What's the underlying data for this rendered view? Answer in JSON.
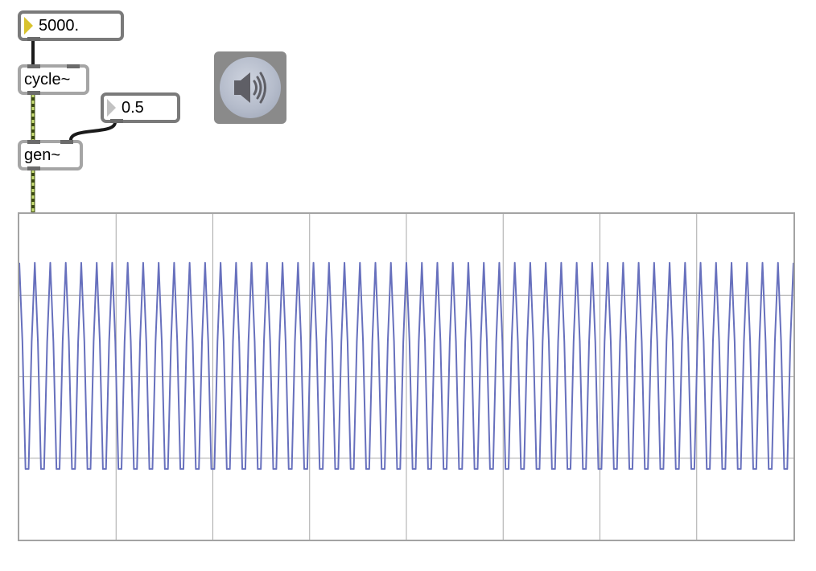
{
  "patch": {
    "frequency_number": {
      "value": "5000."
    },
    "cycle_object": {
      "label": "cycle~"
    },
    "param_number": {
      "value": "0.5"
    },
    "gen_object": {
      "label": "gen~"
    },
    "dac_button": {
      "icon": "speaker-icon"
    }
  },
  "scope": {
    "type": "oscilloscope",
    "trace_color": "#6770bd",
    "grid_color": "#a8a8a8",
    "vertical_divisions": 8,
    "horizontal_divisions": 4,
    "signal_range": [
      -1,
      1
    ],
    "trace_amplitude": 0.7,
    "cycles_shown": 50
  },
  "colors": {
    "signal_cord": "#c6dc71",
    "control_cord": "#1a1a1a",
    "number_triangle": "#d9c32e"
  }
}
